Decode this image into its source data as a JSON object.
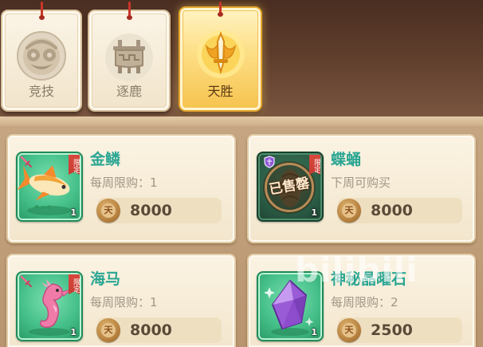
{
  "tabs": [
    {
      "label": "竞技",
      "icon": "arena-emblem-icon",
      "active": false
    },
    {
      "label": "逐鹿",
      "icon": "ding-cauldron-icon",
      "active": false
    },
    {
      "label": "天胜",
      "icon": "sword-emblem-icon",
      "active": true
    }
  ],
  "shop": {
    "currency_glyph": "天",
    "currency_icon": "tian-coin-icon",
    "items": [
      {
        "name": "金鳞",
        "limit_text": "每周限购：1",
        "price": 8000,
        "quantity": 1,
        "badge": "限定",
        "icon": "golden-koi-icon",
        "corner_icon": "pink-sword-icon",
        "sold_out": false
      },
      {
        "name": "蝶蛹",
        "limit_text": "下周可购买",
        "price": 8000,
        "quantity": 1,
        "badge": "限定",
        "icon": "chrysalis-icon",
        "corner_icon": "purple-shield-icon",
        "sold_out": true,
        "sold_out_stamp": "已售罄"
      },
      {
        "name": "海马",
        "limit_text": "每周限购：1",
        "price": 8000,
        "quantity": 1,
        "badge": "限定",
        "icon": "seahorse-icon",
        "corner_icon": "pink-sword-icon",
        "sold_out": false
      },
      {
        "name": "神秘晶曜石",
        "limit_text": "每周限购：2",
        "price": 2500,
        "quantity": 1,
        "icon": "purple-crystal-icon",
        "sold_out": false
      }
    ]
  },
  "watermark": "bilibili",
  "colors": {
    "item_name": "#2aa693",
    "limit_text": "#a29686",
    "price_text": "#5c4a38",
    "badge": "#c83c32",
    "item_frame": "#46c08a",
    "active_tab": "#f6c34d",
    "inactive_tab": "#f1e4cb"
  }
}
